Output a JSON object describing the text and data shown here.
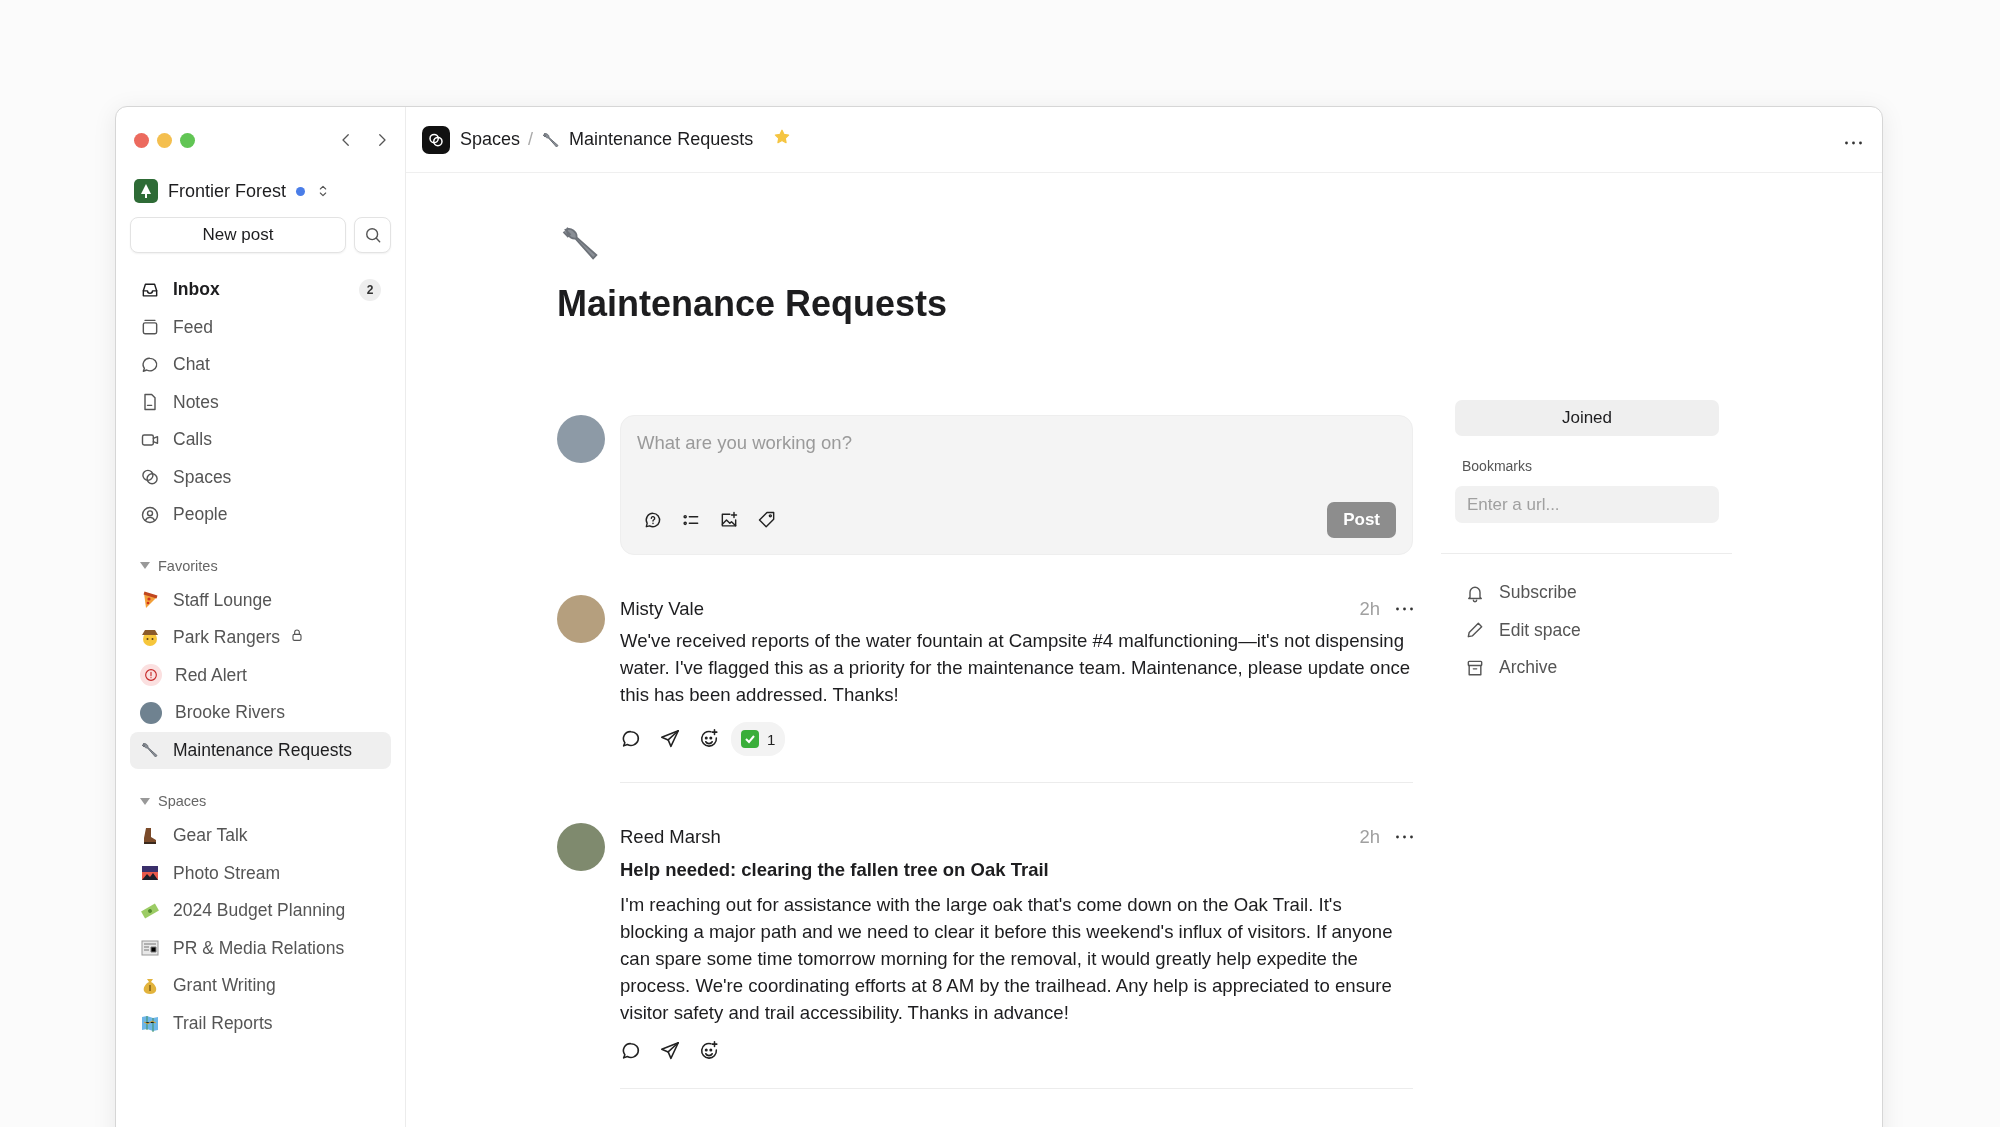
{
  "sidebar": {
    "workspace": {
      "name": "Frontier Forest"
    },
    "new_post_button": "New post",
    "nav": [
      {
        "label": "Inbox",
        "badge": "2",
        "unread": true,
        "selected": false
      },
      {
        "label": "Feed",
        "unread": false,
        "selected": false
      },
      {
        "label": "Chat",
        "unread": false,
        "selected": false
      },
      {
        "label": "Notes",
        "unread": false,
        "selected": false
      },
      {
        "label": "Calls",
        "unread": false,
        "selected": false
      },
      {
        "label": "Spaces",
        "unread": false,
        "selected": false
      },
      {
        "label": "People",
        "unread": false,
        "selected": false
      }
    ],
    "sections": [
      {
        "title": "Favorites",
        "expanded": true,
        "items": [
          {
            "label": "Staff Lounge",
            "locked": false,
            "selected": false
          },
          {
            "label": "Park Rangers",
            "locked": true,
            "selected": false
          },
          {
            "label": "Red Alert",
            "locked": false,
            "selected": false
          },
          {
            "label": "Brooke Rivers",
            "locked": false,
            "selected": false
          },
          {
            "label": "Maintenance Requests",
            "locked": false,
            "selected": true
          }
        ]
      },
      {
        "title": "Spaces",
        "expanded": true,
        "items": [
          {
            "label": "Gear Talk",
            "locked": false,
            "selected": false
          },
          {
            "label": "Photo Stream",
            "locked": false,
            "selected": false
          },
          {
            "label": "2024 Budget Planning",
            "locked": false,
            "selected": false
          },
          {
            "label": "PR & Media Relations",
            "locked": false,
            "selected": false
          },
          {
            "label": "Grant Writing",
            "locked": false,
            "selected": false
          },
          {
            "label": "Trail Reports",
            "locked": false,
            "selected": false
          }
        ]
      }
    ]
  },
  "header": {
    "breadcrumb": [
      "Spaces",
      "Maintenance Requests"
    ],
    "breadcrumb_separator": "/",
    "starred": true
  },
  "space": {
    "title": "Maintenance Requests"
  },
  "composer": {
    "placeholder": "What are you working on?",
    "post_button": {
      "label": "Post",
      "disabled": true
    }
  },
  "posts": [
    {
      "author": "Misty Vale",
      "time": "2h",
      "body": "We've received reports of the water fountain at Campsite #4 malfunctioning—it's not dispensing water. I've flagged this as a priority for the maintenance team. Maintenance, please update once this has been addressed. Thanks!",
      "reactions": [
        {
          "count": "1"
        }
      ]
    },
    {
      "author": "Reed Marsh",
      "time": "2h",
      "title": "Help needed: clearing the fallen tree on Oak Trail",
      "body": "I'm reaching out for assistance with the large oak that's come down on the Oak Trail. It's blocking a major path and we need to clear it before this weekend's influx of visitors. If anyone can spare some time tomorrow morning for the removal, it would greatly help expedite the process. We're coordinating efforts at 8 AM by the trailhead. Any help is appreciated to ensure visitor safety and trail accessibility. Thanks in advance!"
    }
  ],
  "side_panel": {
    "join_button": "Joined",
    "bookmarks_label": "Bookmarks",
    "url_placeholder": "Enter a url...",
    "actions": [
      "Subscribe",
      "Edit space",
      "Archive"
    ]
  }
}
